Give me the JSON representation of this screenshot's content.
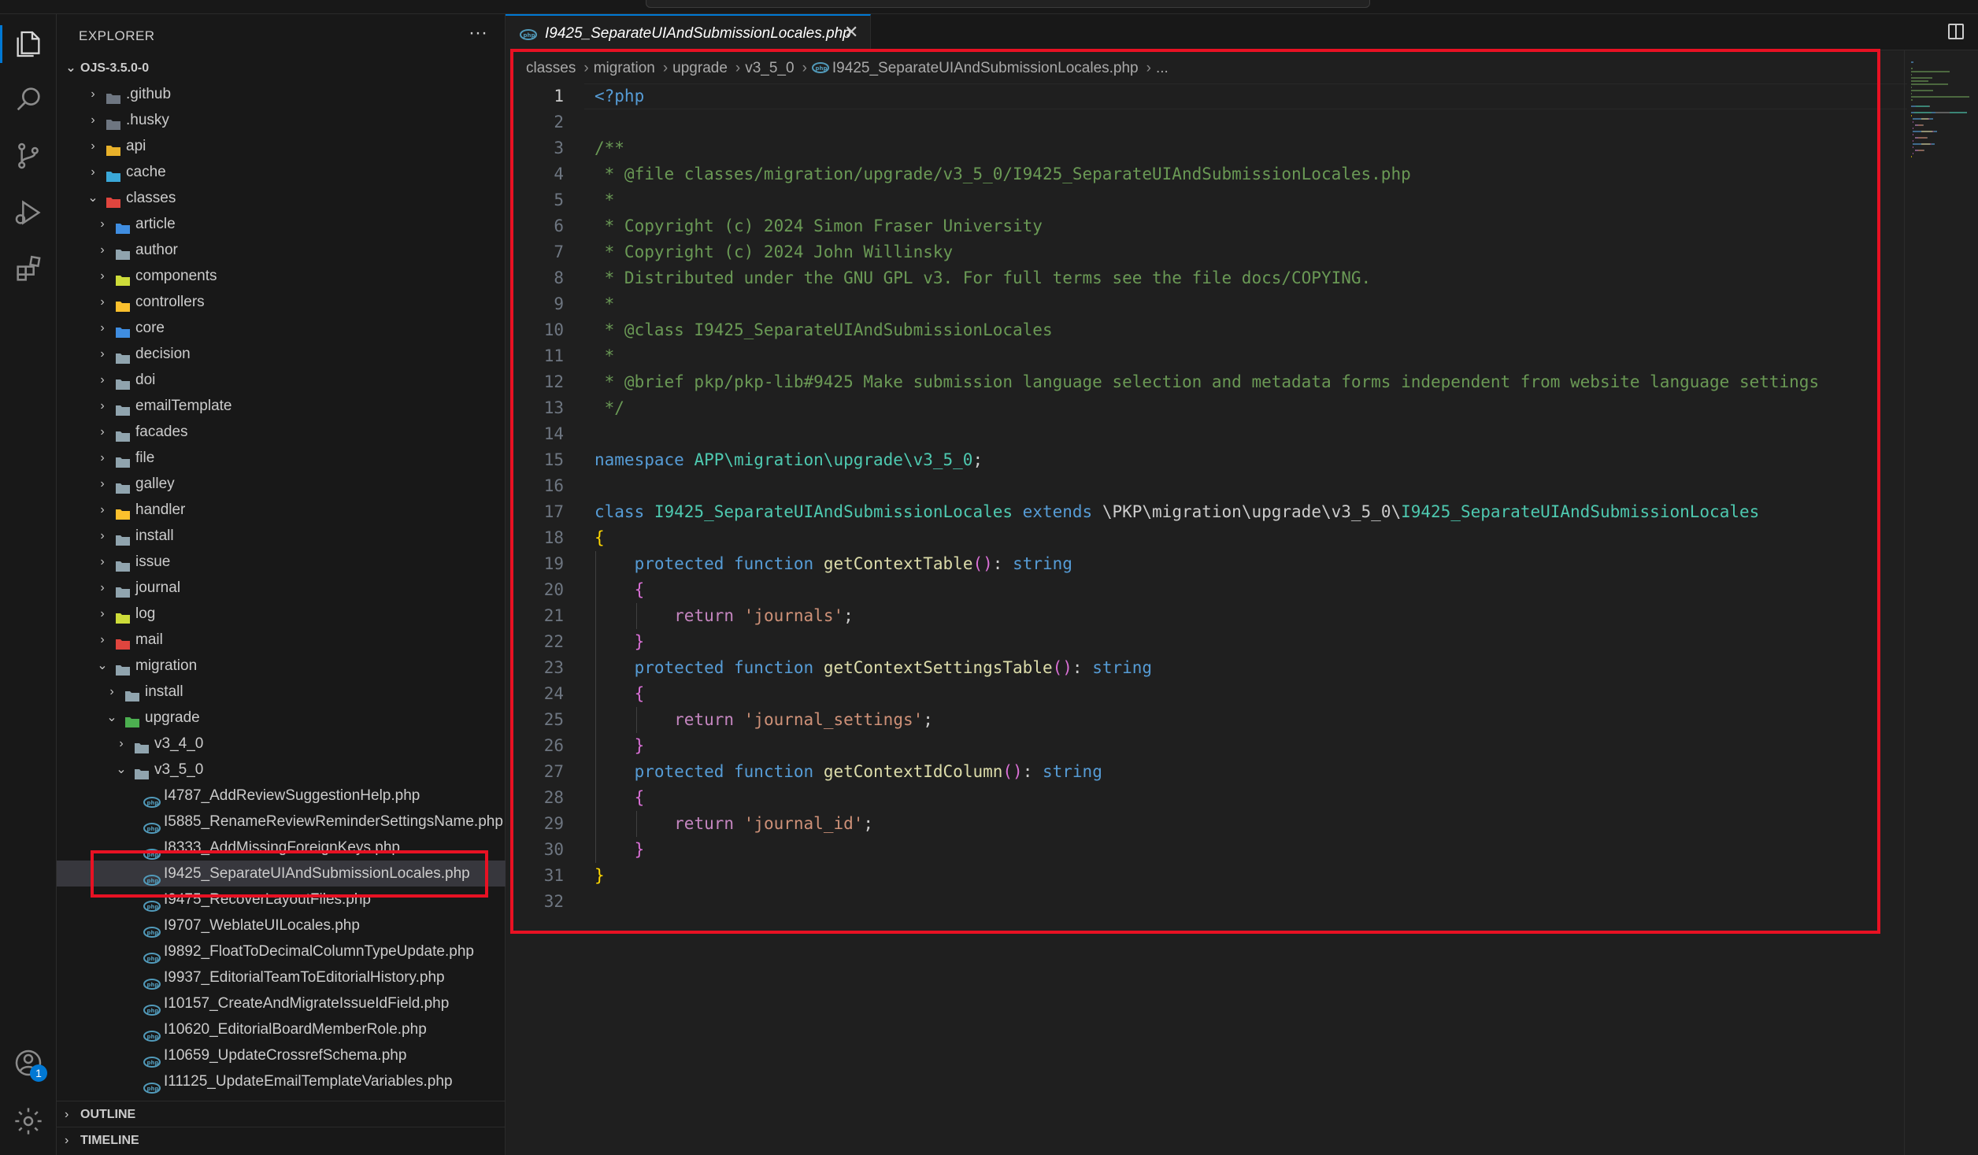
{
  "explorer": {
    "header": "EXPLORER",
    "more": "···",
    "root": "OJS-3.5.0-0",
    "items": [
      {
        "label": ".github",
        "depth": 1,
        "kind": "folder",
        "open": false,
        "color": "#6e7681"
      },
      {
        "label": ".husky",
        "depth": 1,
        "kind": "folder",
        "open": false,
        "color": "#6e7681"
      },
      {
        "label": "api",
        "depth": 1,
        "kind": "folder",
        "open": false,
        "color": "#e8b12a"
      },
      {
        "label": "cache",
        "depth": 1,
        "kind": "folder",
        "open": false,
        "color": "#3aa8d8"
      },
      {
        "label": "classes",
        "depth": 1,
        "kind": "folder",
        "open": true,
        "color": "#e0453e"
      },
      {
        "label": "article",
        "depth": 2,
        "kind": "folder",
        "open": false,
        "color": "#3f8de0"
      },
      {
        "label": "author",
        "depth": 2,
        "kind": "folder",
        "open": false,
        "color": "#90a4ae"
      },
      {
        "label": "components",
        "depth": 2,
        "kind": "folder",
        "open": false,
        "color": "#cddc39"
      },
      {
        "label": "controllers",
        "depth": 2,
        "kind": "folder",
        "open": false,
        "color": "#fbc02d"
      },
      {
        "label": "core",
        "depth": 2,
        "kind": "folder",
        "open": false,
        "color": "#3f8de0"
      },
      {
        "label": "decision",
        "depth": 2,
        "kind": "folder",
        "open": false,
        "color": "#90a4ae"
      },
      {
        "label": "doi",
        "depth": 2,
        "kind": "folder",
        "open": false,
        "color": "#90a4ae"
      },
      {
        "label": "emailTemplate",
        "depth": 2,
        "kind": "folder",
        "open": false,
        "color": "#90a4ae"
      },
      {
        "label": "facades",
        "depth": 2,
        "kind": "folder",
        "open": false,
        "color": "#90a4ae"
      },
      {
        "label": "file",
        "depth": 2,
        "kind": "folder",
        "open": false,
        "color": "#90a4ae"
      },
      {
        "label": "galley",
        "depth": 2,
        "kind": "folder",
        "open": false,
        "color": "#90a4ae"
      },
      {
        "label": "handler",
        "depth": 2,
        "kind": "folder",
        "open": false,
        "color": "#fbc02d"
      },
      {
        "label": "install",
        "depth": 2,
        "kind": "folder",
        "open": false,
        "color": "#90a4ae"
      },
      {
        "label": "issue",
        "depth": 2,
        "kind": "folder",
        "open": false,
        "color": "#90a4ae"
      },
      {
        "label": "journal",
        "depth": 2,
        "kind": "folder",
        "open": false,
        "color": "#90a4ae"
      },
      {
        "label": "log",
        "depth": 2,
        "kind": "folder",
        "open": false,
        "color": "#cddc39"
      },
      {
        "label": "mail",
        "depth": 2,
        "kind": "folder",
        "open": false,
        "color": "#e0453e"
      },
      {
        "label": "migration",
        "depth": 2,
        "kind": "folder",
        "open": true,
        "color": "#90a4ae"
      },
      {
        "label": "install",
        "depth": 3,
        "kind": "folder",
        "open": false,
        "color": "#90a4ae"
      },
      {
        "label": "upgrade",
        "depth": 3,
        "kind": "folder",
        "open": true,
        "color": "#4caf50"
      },
      {
        "label": "v3_4_0",
        "depth": 4,
        "kind": "folder",
        "open": false,
        "color": "#90a4ae"
      },
      {
        "label": "v3_5_0",
        "depth": 4,
        "kind": "folder",
        "open": true,
        "color": "#90a4ae"
      },
      {
        "label": "I4787_AddReviewSuggestionHelp.php",
        "depth": 5,
        "kind": "php"
      },
      {
        "label": "I5885_RenameReviewReminderSettingsName.php",
        "depth": 5,
        "kind": "php"
      },
      {
        "label": "I8333_AddMissingForeignKeys.php",
        "depth": 5,
        "kind": "php"
      },
      {
        "label": "I9425_SeparateUIAndSubmissionLocales.php",
        "depth": 5,
        "kind": "php",
        "selected": true
      },
      {
        "label": "I9475_RecoverLayoutFiles.php",
        "depth": 5,
        "kind": "php"
      },
      {
        "label": "I9707_WeblateUILocales.php",
        "depth": 5,
        "kind": "php"
      },
      {
        "label": "I9892_FloatToDecimalColumnTypeUpdate.php",
        "depth": 5,
        "kind": "php"
      },
      {
        "label": "I9937_EditorialTeamToEditorialHistory.php",
        "depth": 5,
        "kind": "php"
      },
      {
        "label": "I10157_CreateAndMigrateIssueIdField.php",
        "depth": 5,
        "kind": "php"
      },
      {
        "label": "I10620_EditorialBoardMemberRole.php",
        "depth": 5,
        "kind": "php"
      },
      {
        "label": "I10659_UpdateCrossrefSchema.php",
        "depth": 5,
        "kind": "php"
      },
      {
        "label": "I11125_UpdateEmailTemplateVariables.php",
        "depth": 5,
        "kind": "php"
      }
    ],
    "outline": "OUTLINE",
    "timeline": "TIMELINE"
  },
  "activity": {
    "accounts_badge": "1"
  },
  "tab": {
    "label": "I9425_SeparateUIAndSubmissionLocales.php",
    "close": "✕"
  },
  "breadcrumb": [
    "classes",
    "migration",
    "upgrade",
    "v3_5_0",
    "I9425_SeparateUIAndSubmissionLocales.php",
    "..."
  ],
  "code": {
    "current_line": 1,
    "lines": [
      [
        [
          "t-tag",
          "<?php"
        ]
      ],
      [],
      [
        [
          "t-cm",
          "/**"
        ]
      ],
      [
        [
          "t-cm",
          " * @file classes/migration/upgrade/v3_5_0/I9425_SeparateUIAndSubmissionLocales.php"
        ]
      ],
      [
        [
          "t-cm",
          " *"
        ]
      ],
      [
        [
          "t-cm",
          " * Copyright (c) 2024 Simon Fraser University"
        ]
      ],
      [
        [
          "t-cm",
          " * Copyright (c) 2024 John Willinsky"
        ]
      ],
      [
        [
          "t-cm",
          " * Distributed under the GNU GPL v3. For full terms see the file docs/COPYING."
        ]
      ],
      [
        [
          "t-cm",
          " *"
        ]
      ],
      [
        [
          "t-cm",
          " * @class I9425_SeparateUIAndSubmissionLocales"
        ]
      ],
      [
        [
          "t-cm",
          " *"
        ]
      ],
      [
        [
          "t-cm",
          " * @brief pkp/pkp-lib#9425 Make submission language selection and metadata forms independent from website language settings"
        ]
      ],
      [
        [
          "t-cm",
          " */"
        ]
      ],
      [],
      [
        [
          "t-kw",
          "namespace "
        ],
        [
          "t-ns",
          "APP\\migration\\upgrade\\v3_5_0"
        ],
        [
          "t-txt",
          ";"
        ]
      ],
      [],
      [
        [
          "t-kw",
          "class "
        ],
        [
          "t-cls",
          "I9425_SeparateUIAndSubmissionLocales "
        ],
        [
          "t-kw",
          "extends "
        ],
        [
          "t-txt",
          "\\PKP\\migration\\upgrade\\v3_5_0\\"
        ],
        [
          "t-cls",
          "I9425_SeparateUIAndSubmissionLocales"
        ]
      ],
      [
        [
          "t-br1",
          "{"
        ]
      ],
      [
        [
          "t-txt",
          "    "
        ],
        [
          "t-kw",
          "protected "
        ],
        [
          "t-kw",
          "function "
        ],
        [
          "t-fn",
          "getContextTable"
        ],
        [
          "t-br2",
          "()"
        ],
        [
          "t-txt",
          ": "
        ],
        [
          "t-kw",
          "string"
        ]
      ],
      [
        [
          "t-txt",
          "    "
        ],
        [
          "t-br2",
          "{"
        ]
      ],
      [
        [
          "t-txt",
          "        "
        ],
        [
          "t-ctl",
          "return "
        ],
        [
          "t-str",
          "'journals'"
        ],
        [
          "t-txt",
          ";"
        ]
      ],
      [
        [
          "t-txt",
          "    "
        ],
        [
          "t-br2",
          "}"
        ]
      ],
      [
        [
          "t-txt",
          "    "
        ],
        [
          "t-kw",
          "protected "
        ],
        [
          "t-kw",
          "function "
        ],
        [
          "t-fn",
          "getContextSettingsTable"
        ],
        [
          "t-br2",
          "()"
        ],
        [
          "t-txt",
          ": "
        ],
        [
          "t-kw",
          "string"
        ]
      ],
      [
        [
          "t-txt",
          "    "
        ],
        [
          "t-br2",
          "{"
        ]
      ],
      [
        [
          "t-txt",
          "        "
        ],
        [
          "t-ctl",
          "return "
        ],
        [
          "t-str",
          "'journal_settings'"
        ],
        [
          "t-txt",
          ";"
        ]
      ],
      [
        [
          "t-txt",
          "    "
        ],
        [
          "t-br2",
          "}"
        ]
      ],
      [
        [
          "t-txt",
          "    "
        ],
        [
          "t-kw",
          "protected "
        ],
        [
          "t-kw",
          "function "
        ],
        [
          "t-fn",
          "getContextIdColumn"
        ],
        [
          "t-br2",
          "()"
        ],
        [
          "t-txt",
          ": "
        ],
        [
          "t-kw",
          "string"
        ]
      ],
      [
        [
          "t-txt",
          "    "
        ],
        [
          "t-br2",
          "{"
        ]
      ],
      [
        [
          "t-txt",
          "        "
        ],
        [
          "t-ctl",
          "return "
        ],
        [
          "t-str",
          "'journal_id'"
        ],
        [
          "t-txt",
          ";"
        ]
      ],
      [
        [
          "t-txt",
          "    "
        ],
        [
          "t-br2",
          "}"
        ]
      ],
      [
        [
          "t-br1",
          "}"
        ]
      ],
      []
    ]
  },
  "colors": {
    "accent": "#0078d4",
    "highlight_box": "#e81123",
    "php_icon": "#519aba"
  }
}
